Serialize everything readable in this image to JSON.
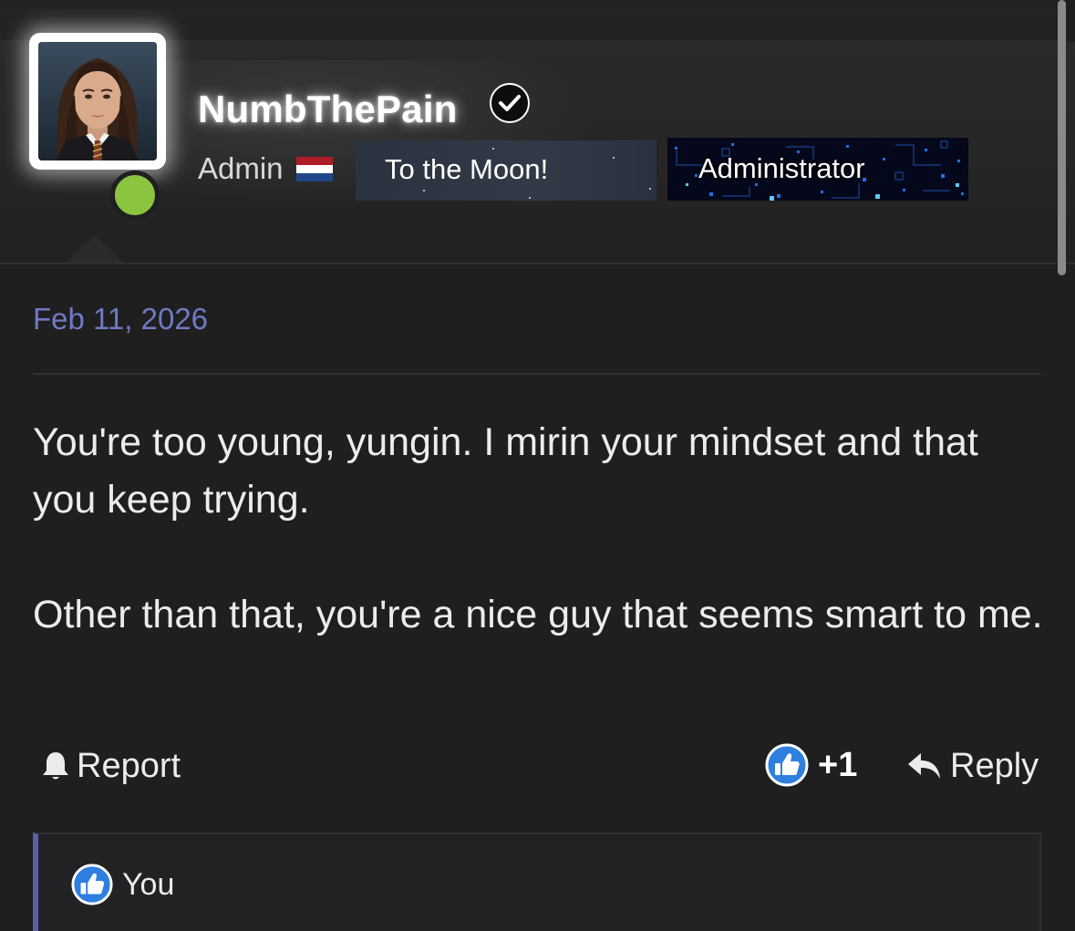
{
  "user": {
    "username": "NumbThePain",
    "role": "Admin",
    "flag": "netherlands-flag-icon",
    "online": true,
    "banners": [
      {
        "label": "To the Moon!"
      },
      {
        "label": "Administrator"
      }
    ]
  },
  "post": {
    "date": "Feb 11, 2026",
    "paragraphs": [
      "You're too young, yungin. I mirin your mindset and that you keep trying.",
      "Other than that, you're a nice guy that seems smart to me."
    ]
  },
  "actions": {
    "report_label": "Report",
    "like_count": "+1",
    "reply_label": "Reply"
  },
  "reactions": {
    "users": "You"
  },
  "colors": {
    "background": "#1f1f20",
    "date": "#6f7ac4",
    "online": "#8bc53f",
    "like_blue": "#2f7fe0",
    "reaction_border": "#5a5fa8"
  }
}
